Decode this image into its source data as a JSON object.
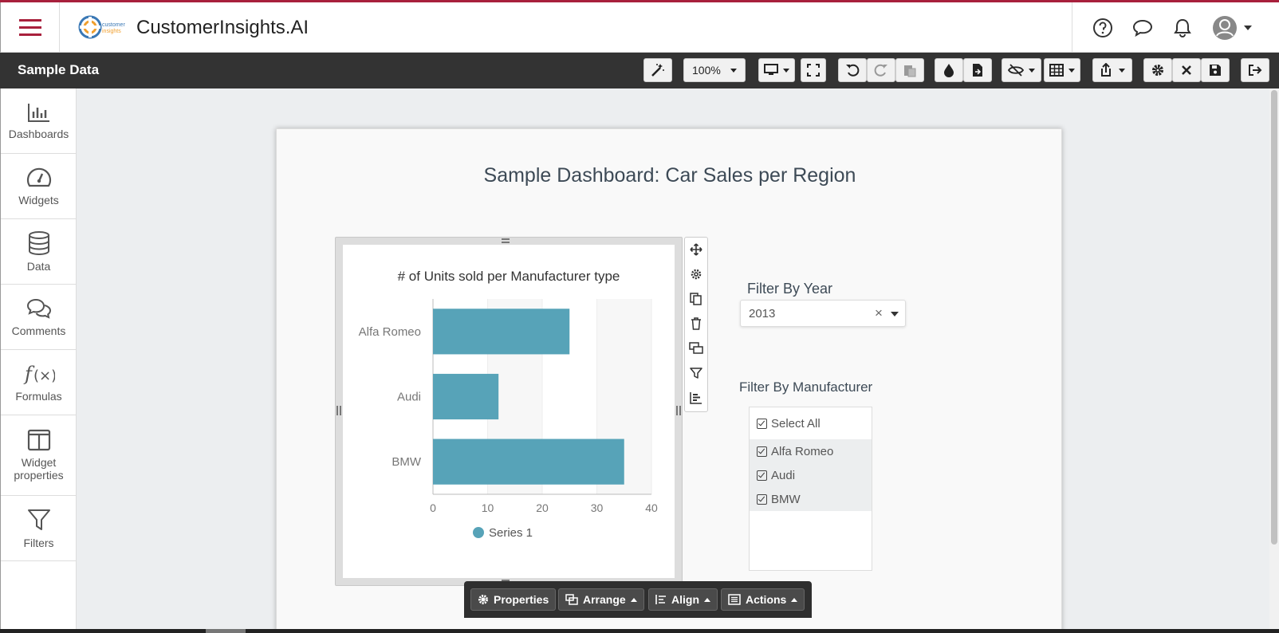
{
  "app": {
    "title": "CustomerInsights.AI",
    "logo_text": "customer insights"
  },
  "toolbar": {
    "title": "Sample Data",
    "zoom": "100%"
  },
  "sidebar": {
    "items": [
      {
        "label": "Dashboards",
        "icon": "bar-chart-icon"
      },
      {
        "label": "Widgets",
        "icon": "gauge-icon"
      },
      {
        "label": "Data",
        "icon": "database-icon"
      },
      {
        "label": "Comments",
        "icon": "comments-icon"
      },
      {
        "label": "Formulas",
        "icon": "formula-icon"
      },
      {
        "label": "Widget properties",
        "icon": "columns-icon"
      },
      {
        "label": "Filters",
        "icon": "filter-icon"
      }
    ]
  },
  "dashboard": {
    "title": "Sample Dashboard: Car Sales per Region"
  },
  "chart_data": {
    "type": "bar",
    "orientation": "horizontal",
    "title": "# of Units sold per Manufacturer type",
    "categories": [
      "Alfa Romeo",
      "Audi",
      "BMW"
    ],
    "series": [
      {
        "name": "Series 1",
        "values": [
          25,
          12,
          35
        ],
        "color": "#57a3b8"
      }
    ],
    "xlim": [
      0,
      40
    ],
    "ticks": [
      "0",
      "10",
      "20",
      "30",
      "40"
    ],
    "xlabel": "",
    "ylabel": "",
    "grid": true,
    "legend": "bottom"
  },
  "filters": {
    "year": {
      "label": "Filter By Year",
      "value": "2013"
    },
    "manufacturer": {
      "label": "Filter By Manufacturer",
      "select_all": "Select All",
      "options": [
        "Alfa Romeo",
        "Audi",
        "BMW"
      ]
    }
  },
  "bottombar": {
    "properties": "Properties",
    "arrange": "Arrange",
    "align": "Align",
    "actions": "Actions"
  },
  "colors": {
    "accent": "#a8203c",
    "toolbar": "#333333",
    "bar": "#57a3b8"
  }
}
